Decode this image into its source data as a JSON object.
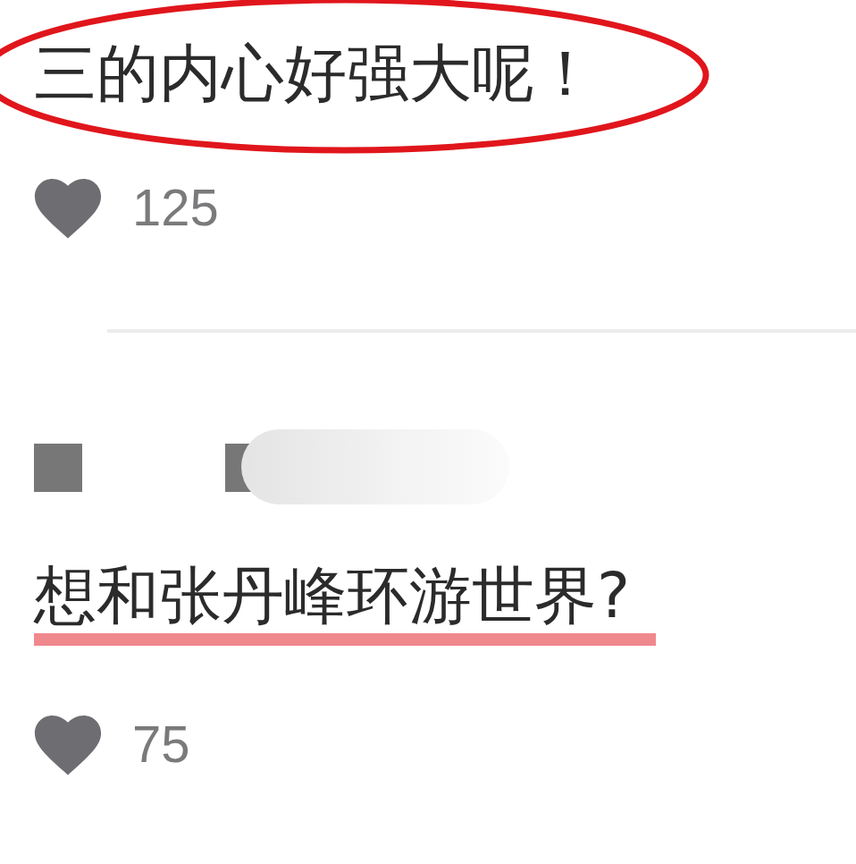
{
  "comments": [
    {
      "text": "三的内心好强大呢！",
      "likes": "125",
      "redacted_author": false,
      "kind": "ellipse"
    },
    {
      "text": "想和张丹峰环游世界?",
      "likes": "75",
      "redacted_author": true,
      "kind": "underline"
    }
  ]
}
